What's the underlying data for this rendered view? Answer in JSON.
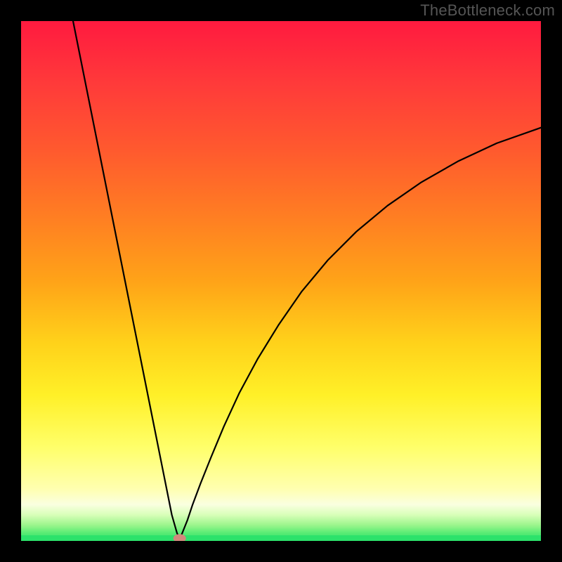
{
  "attribution": "TheBottleneck.com",
  "colors": {
    "frame": "#000000",
    "curve": "#000000",
    "marker_fill": "#d1897c",
    "green_band": "#2ce26b",
    "gradient_stops": [
      {
        "offset": 0.0,
        "color": "#ff1a3f"
      },
      {
        "offset": 0.12,
        "color": "#ff3a3a"
      },
      {
        "offset": 0.25,
        "color": "#ff5a2e"
      },
      {
        "offset": 0.38,
        "color": "#ff7f22"
      },
      {
        "offset": 0.5,
        "color": "#ffa318"
      },
      {
        "offset": 0.62,
        "color": "#ffd21a"
      },
      {
        "offset": 0.72,
        "color": "#fff028"
      },
      {
        "offset": 0.82,
        "color": "#ffff6a"
      },
      {
        "offset": 0.9,
        "color": "#ffffb0"
      },
      {
        "offset": 0.93,
        "color": "#faffe0"
      },
      {
        "offset": 0.95,
        "color": "#d8ffb8"
      },
      {
        "offset": 0.97,
        "color": "#9af58b"
      },
      {
        "offset": 0.985,
        "color": "#58ec74"
      },
      {
        "offset": 1.0,
        "color": "#2ce26b"
      }
    ]
  },
  "chart_data": {
    "type": "line",
    "title": "",
    "xlabel": "",
    "ylabel": "",
    "xlim": [
      0,
      100
    ],
    "ylim": [
      0,
      100
    ],
    "marker": {
      "x": 30.5,
      "y": 0.5
    },
    "curve_points": [
      {
        "x": 10.0,
        "y": 100.0
      },
      {
        "x": 12.0,
        "y": 90.0
      },
      {
        "x": 14.0,
        "y": 80.0
      },
      {
        "x": 16.0,
        "y": 70.0
      },
      {
        "x": 18.0,
        "y": 60.0
      },
      {
        "x": 20.0,
        "y": 50.0
      },
      {
        "x": 22.0,
        "y": 40.0
      },
      {
        "x": 24.0,
        "y": 30.0
      },
      {
        "x": 26.0,
        "y": 20.0
      },
      {
        "x": 28.0,
        "y": 10.0
      },
      {
        "x": 29.0,
        "y": 5.0
      },
      {
        "x": 30.0,
        "y": 1.5
      },
      {
        "x": 30.5,
        "y": 0.5
      },
      {
        "x": 31.0,
        "y": 1.5
      },
      {
        "x": 32.0,
        "y": 4.0
      },
      {
        "x": 33.0,
        "y": 7.0
      },
      {
        "x": 34.5,
        "y": 11.0
      },
      {
        "x": 36.5,
        "y": 16.0
      },
      {
        "x": 39.0,
        "y": 22.0
      },
      {
        "x": 42.0,
        "y": 28.5
      },
      {
        "x": 45.5,
        "y": 35.0
      },
      {
        "x": 49.5,
        "y": 41.5
      },
      {
        "x": 54.0,
        "y": 48.0
      },
      {
        "x": 59.0,
        "y": 54.0
      },
      {
        "x": 64.5,
        "y": 59.5
      },
      {
        "x": 70.5,
        "y": 64.5
      },
      {
        "x": 77.0,
        "y": 69.0
      },
      {
        "x": 84.0,
        "y": 73.0
      },
      {
        "x": 91.5,
        "y": 76.5
      },
      {
        "x": 100.0,
        "y": 79.5
      }
    ]
  }
}
